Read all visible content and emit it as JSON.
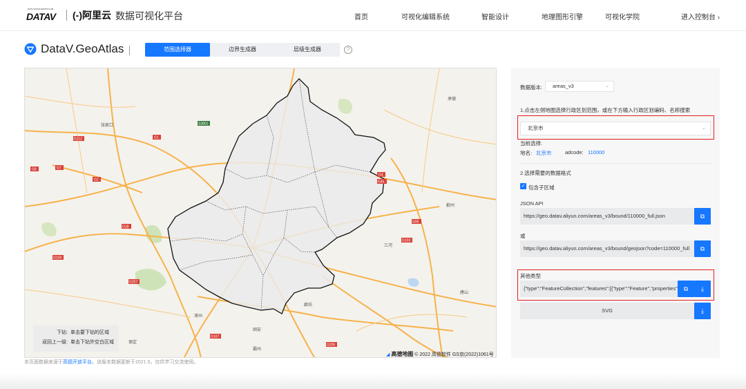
{
  "nav": {
    "logo_tiny": "DATA VISUALIZATION LAB",
    "logo_datav": "DATAV",
    "logo_aliyun": "(-)阿里云",
    "platform": "数据可视化平台",
    "links": [
      "首页",
      "可视化编辑系统",
      "智能设计",
      "地理图形引擎",
      "可视化学院",
      "进入控制台 ›"
    ]
  },
  "header": {
    "title": "DataV.GeoAtlas",
    "tabs": [
      "范围选择器",
      "边界生成器",
      "层级生成器"
    ],
    "active_tab": 0,
    "help_icon": "?"
  },
  "map": {
    "hint_rows": [
      {
        "key": "下钻:",
        "value": "单击要下钻的区域"
      },
      {
        "key": "返回上一级:",
        "value": "单击下钻外空白区域"
      }
    ],
    "credit_brand": "高德地图",
    "credit_text": "© 2022 高德软件 GS京(2022)1061号",
    "labels": [
      "张家口",
      "承德",
      "唐山",
      "廊坊",
      "保定",
      "霸州",
      "涿州",
      "固安",
      "三河",
      "蓟州"
    ],
    "road_shields": [
      "G6",
      "G7",
      "G1",
      "G2",
      "G4",
      "G45",
      "G95",
      "G18",
      "S3801",
      "G112",
      "G207",
      "G103",
      "G205",
      "G109",
      "G107"
    ]
  },
  "footnote": {
    "prefix": "本页面数据来源于",
    "link": "高德开放平台",
    "suffix": "。该版本数据更新于2021.5，仅供学习交流使用。"
  },
  "panel": {
    "version_label": "数据版本:",
    "version_value": "areas_v3",
    "step1": "1.点击左侧地图选择行政区划范围，或在下方输入行政区划编码、名称搜索",
    "region_value": "北京市",
    "current_label": "当前选择:",
    "name_label": "地名:",
    "name_value": "北京市",
    "adcode_label": "adcode:",
    "adcode_value": "110000",
    "step2": "2.选择需要的数据格式",
    "include_sub": "包含子区域",
    "json_api_label": "JSON API",
    "json_api_url": "https://geo.datav.aliyun.com/areas_v3/bound/110000_full.json",
    "or_label": "或",
    "geojson_url": "https://geo.datav.aliyun.com/areas_v3/bound/geojson?code=110000_full",
    "other_label": "其他类型",
    "geojson_text": "{\"type\":\"FeatureCollection\",\"features\":[{\"type\":\"Feature\",\"properties\"",
    "svg_label": "SVG"
  },
  "colors": {
    "accent": "#1677ff",
    "highlight": "#e02020",
    "region_fill": "#ebebeb"
  },
  "icons": {
    "copy": "copy-icon",
    "download": "download-icon",
    "checkbox": "checkbox-checked-icon"
  }
}
